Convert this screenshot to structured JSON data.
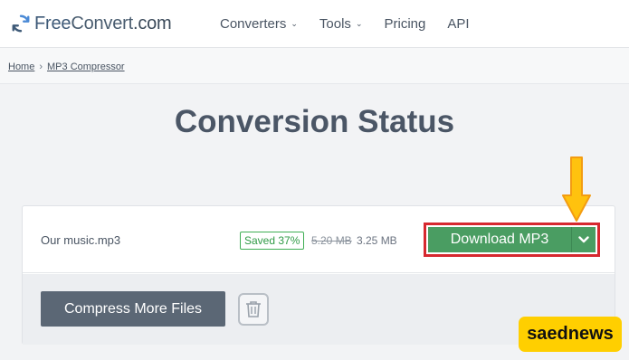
{
  "header": {
    "logo_text_a": "Free",
    "logo_text_b": "Convert",
    "logo_text_c": ".com",
    "logo_icon": "refresh-circle-icon",
    "nav": [
      {
        "label": "Converters",
        "has_dropdown": true
      },
      {
        "label": "Tools",
        "has_dropdown": true
      },
      {
        "label": "Pricing",
        "has_dropdown": false
      },
      {
        "label": "API",
        "has_dropdown": false
      }
    ]
  },
  "breadcrumb": {
    "home": "Home",
    "separator": "›",
    "current": "MP3 Compressor"
  },
  "page": {
    "title": "Conversion Status"
  },
  "file": {
    "name": "Our music.mp3",
    "saved_badge": "Saved 37%",
    "original_size": "5.20 MB",
    "new_size": "3.25 MB",
    "download_label": "Download MP3",
    "dropdown_icon": "chevron-down-icon"
  },
  "actions": {
    "compress_more_label": "Compress More Files",
    "delete_icon": "trash-icon"
  },
  "watermark": {
    "text": "saednews"
  },
  "colors": {
    "accent_green": "#4a9d62",
    "highlight_red": "#d6282f",
    "arrow_yellow": "#ffc20e",
    "watermark_yellow": "#ffcf00",
    "title_gray": "#4b5666"
  }
}
